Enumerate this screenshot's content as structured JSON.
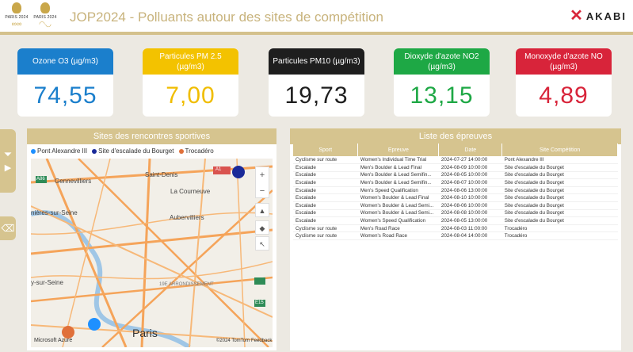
{
  "header": {
    "title": "JOP2024 - Polluants autour des sites de compétition",
    "logo1_label": "PARIS 2024",
    "logo2_label": "PARIS 2024",
    "brand": "AKABI"
  },
  "kpis": [
    {
      "label": "Ozone O3 (µg/m3)",
      "value": "74,55",
      "header_color": "#1b7fcc",
      "value_color": "#1b7fcc"
    },
    {
      "label": "Particules PM 2.5 (µg/m3)",
      "value": "7,00",
      "header_color": "#f3c200",
      "value_color": "#f0bd00"
    },
    {
      "label": "Particules PM10 (µg/m3)",
      "value": "19,73",
      "header_color": "#1e1e1e",
      "value_color": "#1e1e1e"
    },
    {
      "label": "Dioxyde d'azote NO2 (µg/m3)",
      "value": "13,15",
      "header_color": "#1ea845",
      "value_color": "#1ea845"
    },
    {
      "label": "Monoxyde d'azote NO (µg/m3)",
      "value": "4,89",
      "header_color": "#d8243a",
      "value_color": "#d8243a"
    }
  ],
  "map_panel": {
    "title": "Sites des rencontres sportives",
    "legend": [
      {
        "label": "Pont Alexandre III",
        "color": "#1e90ff"
      },
      {
        "label": "Site d'escalade du Bourget",
        "color": "#1a2a99"
      },
      {
        "label": "Trocadéro",
        "color": "#e0703a"
      }
    ],
    "labels": {
      "saint_denis": "Saint-Denis",
      "a1": "A1",
      "gennevilliers": "Gennevilliers",
      "la_courneuve": "La Courneuve",
      "asnieres": "nières-sur-Seine",
      "aubervilliers": "Aubervilliers",
      "sur_seine": "y-sur-Seine",
      "arrondissement": "19E ARRONDISSEMENT",
      "paris": "Paris",
      "a86": "A86",
      "e15": "E15",
      "attribution": "©2024 TomTom",
      "feedback": "Feedback",
      "provider": "Microsoft Azure"
    }
  },
  "table_panel": {
    "title": "Liste des épreuves",
    "columns": [
      "Sport",
      "Epreuve",
      "Date",
      "Site Compétition"
    ],
    "rows": [
      [
        "Cyclisme sur route",
        "Women's Individual Time Trial",
        "2024-07-27 14:00:00",
        "Pont Alexandre III"
      ],
      [
        "Escalade",
        "Men's Boulder & Lead Final",
        "2024-08-09 10:00:00",
        "Site d'escalade du Bourget"
      ],
      [
        "Escalade",
        "Men's Boulder & Lead Semifin...",
        "2024-08-05 10:00:00",
        "Site d'escalade du Bourget"
      ],
      [
        "Escalade",
        "Men's Boulder & Lead Semifin...",
        "2024-08-07 10:00:00",
        "Site d'escalade du Bourget"
      ],
      [
        "Escalade",
        "Men's Speed Qualification",
        "2024-08-06 13:00:00",
        "Site d'escalade du Bourget"
      ],
      [
        "Escalade",
        "Women's Boulder & Lead Final",
        "2024-08-10 10:00:00",
        "Site d'escalade du Bourget"
      ],
      [
        "Escalade",
        "Women's Boulder & Lead Semi...",
        "2024-08-06 10:00:00",
        "Site d'escalade du Bourget"
      ],
      [
        "Escalade",
        "Women's Boulder & Lead Semi...",
        "2024-08-08 10:00:00",
        "Site d'escalade du Bourget"
      ],
      [
        "Escalade",
        "Women's Speed Qualification",
        "2024-08-05 13:00:00",
        "Site d'escalade du Bourget"
      ],
      [
        "Cyclisme sur route",
        "Men's Road Race",
        "2024-08-03 11:00:00",
        "Trocadéro"
      ],
      [
        "Cyclisme sur route",
        "Women's Road Race",
        "2024-08-04 14:00:00",
        "Trocadéro"
      ]
    ]
  }
}
